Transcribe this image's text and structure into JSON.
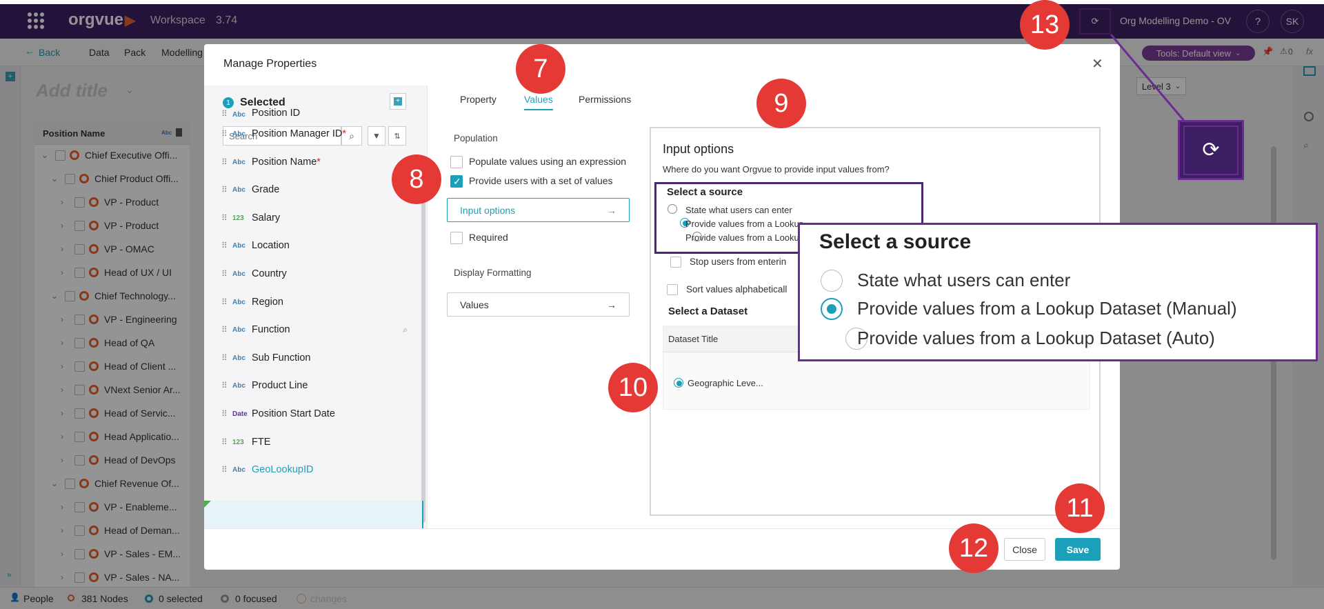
{
  "topbar": {
    "logo": "orgvue",
    "workspace": "Workspace",
    "version": "3.74",
    "dataset_name": "Org Modelling Demo - OV",
    "help": "?",
    "user_initials": "SK"
  },
  "menubar": {
    "back": "Back",
    "items": [
      "Data",
      "Pack",
      "Modelling"
    ],
    "tools_label": "Tools: Default view",
    "alerts_count": "0",
    "fx": "fx"
  },
  "app": {
    "title_placeholder": "Add title",
    "level_select": "Level 3",
    "tree_header": "Position Name",
    "tree_rows": [
      {
        "label": "Chief Executive Offi...",
        "level": 0,
        "expanded": true
      },
      {
        "label": "Chief Product Offi...",
        "level": 1,
        "expanded": true
      },
      {
        "label": "VP - Product",
        "level": 2,
        "expanded": false
      },
      {
        "label": "VP - Product",
        "level": 2,
        "expanded": false
      },
      {
        "label": "VP - OMAC",
        "level": 2,
        "expanded": false
      },
      {
        "label": "Head of UX / UI",
        "level": 2,
        "expanded": false
      },
      {
        "label": "Chief Technology...",
        "level": 1,
        "expanded": true
      },
      {
        "label": "VP - Engineering",
        "level": 2,
        "expanded": false
      },
      {
        "label": "Head of QA",
        "level": 2,
        "expanded": false
      },
      {
        "label": "Head of Client ...",
        "level": 2,
        "expanded": false
      },
      {
        "label": "VNext Senior Ar...",
        "level": 2,
        "expanded": false
      },
      {
        "label": "Head of Servic...",
        "level": 2,
        "expanded": false
      },
      {
        "label": "Head Applicatio...",
        "level": 2,
        "expanded": false
      },
      {
        "label": "Head of DevOps",
        "level": 2,
        "expanded": false
      },
      {
        "label": "Chief Revenue Of...",
        "level": 1,
        "expanded": true
      },
      {
        "label": "VP - Enableme...",
        "level": 2,
        "expanded": false
      },
      {
        "label": "Head of Deman...",
        "level": 2,
        "expanded": false
      },
      {
        "label": "VP - Sales - EM...",
        "level": 2,
        "expanded": false
      },
      {
        "label": "VP - Sales - NA...",
        "level": 2,
        "expanded": false
      }
    ]
  },
  "statusbar": {
    "people": "People",
    "nodes": "381 Nodes",
    "selected": "0 selected",
    "focused": "0 focused",
    "changes": "changes"
  },
  "modal": {
    "title": "Manage Properties",
    "selected_count": "1",
    "selected_label": "Selected",
    "search_placeholder": "Search",
    "properties": [
      {
        "type": "Abc",
        "name": "Position ID",
        "required": false
      },
      {
        "type": "Abc",
        "name": "Position Manager ID",
        "required": true
      },
      {
        "type": "Abc",
        "name": "Position Name",
        "required": true
      },
      {
        "type": "Abc",
        "name": "Grade",
        "required": false
      },
      {
        "type": "123",
        "name": "Salary",
        "required": false
      },
      {
        "type": "Abc",
        "name": "Location",
        "required": false
      },
      {
        "type": "Abc",
        "name": "Country",
        "required": false
      },
      {
        "type": "Abc",
        "name": "Region",
        "required": false
      },
      {
        "type": "Abc",
        "name": "Function",
        "required": false
      },
      {
        "type": "Abc",
        "name": "Sub Function",
        "required": false
      },
      {
        "type": "Abc",
        "name": "Product Line",
        "required": false
      },
      {
        "type": "Date",
        "name": "Position Start Date",
        "required": false
      },
      {
        "type": "123",
        "name": "FTE",
        "required": false
      },
      {
        "type": "Abc",
        "name": "GeoLookupID",
        "required": false
      }
    ],
    "tabs": [
      "Property",
      "Values",
      "Permissions"
    ],
    "active_tab": "Values",
    "population_label": "Population",
    "populate_expression": "Populate values using an expression",
    "provide_set": "Provide users with a set of values",
    "input_options_btn": "Input options",
    "required": "Required",
    "display_formatting": "Display Formatting",
    "values_btn": "Values",
    "input_options": {
      "heading": "Input options",
      "question": "Where do you want Orgvue to provide input values from?",
      "select_source": "Select a source",
      "sources": [
        "State what users can enter",
        "Provide values from a Lookup Dataset (Manual)",
        "Provide values from a Lookup Dataset (Auto)"
      ],
      "sources_truncated": [
        "State what users can enter",
        "Provide values from a Lookup Dataset (Manual)",
        "Provide values from a Lookup Dataset (Auto)"
      ],
      "selected_source": 1,
      "stop_users": "Stop users from entering",
      "sort_values": "Sort values alphabeticall",
      "select_dataset": "Select a Dataset",
      "dataset_col": "Dataset Title",
      "dataset_row": "Geographic Leve..."
    },
    "close_btn": "Close",
    "save_btn": "Save"
  },
  "callout": {
    "title": "Select a source",
    "options": [
      "State what users can enter",
      "Provide values from a Lookup Dataset (Manual)",
      "Provide values from a Lookup Dataset (Auto)"
    ],
    "selected": 1
  },
  "badges": [
    "7",
    "8",
    "9",
    "10",
    "11",
    "12",
    "13"
  ],
  "colors": {
    "brand": "#3d1f63",
    "accent": "#1c9fb8",
    "badge": "#e53935",
    "highlight": "#6a2c91"
  }
}
